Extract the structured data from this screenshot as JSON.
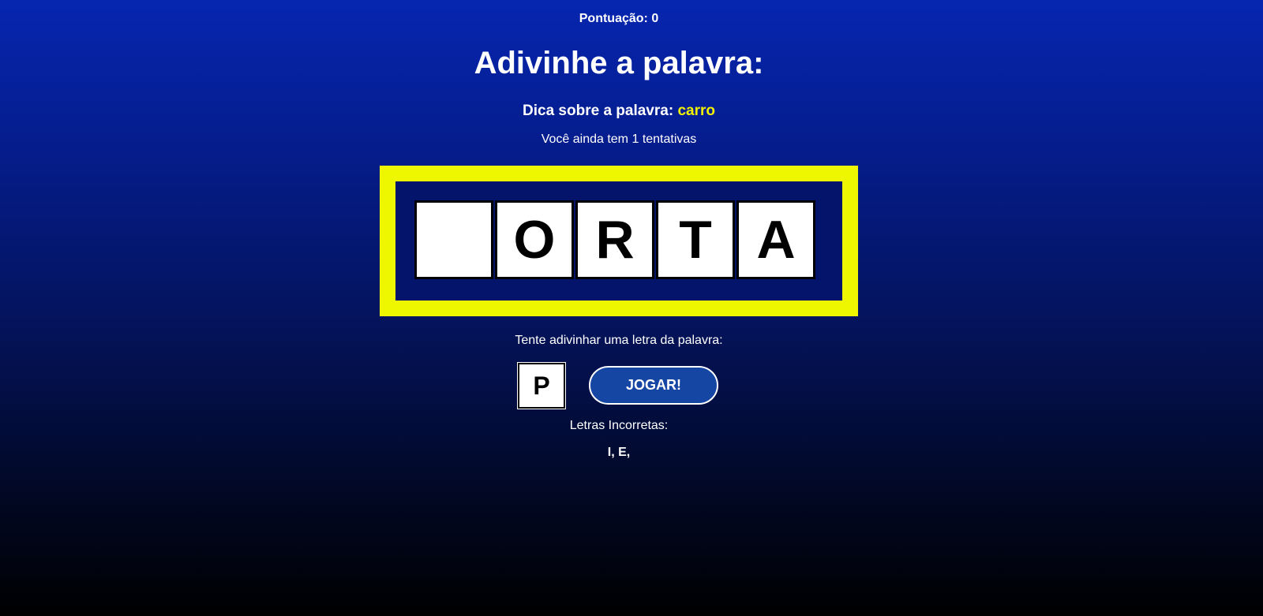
{
  "score": {
    "label": "Pontuação:",
    "value": "0"
  },
  "title": "Adivinhe a palavra:",
  "hint": {
    "label": "Dica sobre a palavra:",
    "value": "carro"
  },
  "attempts": {
    "prefix": "Você ainda tem",
    "count": "1",
    "suffix": "tentativas"
  },
  "word": {
    "tiles": [
      "",
      "O",
      "R",
      "T",
      "A"
    ]
  },
  "guess": {
    "prompt": "Tente adivinhar uma letra da palavra:",
    "value": "P",
    "button_label": "JOGAR!"
  },
  "wrong": {
    "label": "Letras Incorretas:",
    "letters": "I, E,"
  },
  "colors": {
    "board_border": "#eef700",
    "board_background": "#04146a",
    "hint_accent": "#f2f200",
    "button_background": "#1646a4"
  }
}
